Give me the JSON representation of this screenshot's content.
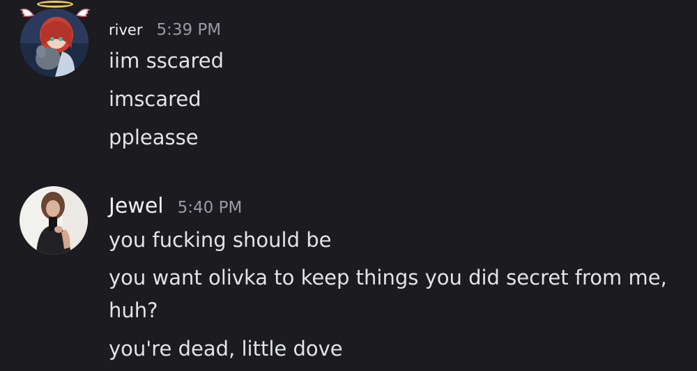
{
  "colors": {
    "background": "#1b1b20",
    "text": "#e3e4e8",
    "timestamp": "#9a9ba3",
    "halo": "#f2c94c"
  },
  "messages": [
    {
      "author": "river",
      "time": "5:39 PM",
      "avatar_icon": "anime-girl-avatar-icon",
      "lines": [
        "iim sscared",
        "imscared",
        "ppleasse"
      ]
    },
    {
      "author": "Jewel",
      "time": "5:40 PM",
      "avatar_icon": "selfie-photo-avatar-icon",
      "lines": [
        "you fucking should be",
        "you want olivka to keep things you did secret from me,",
        "huh?",
        "you're dead, little dove"
      ]
    }
  ]
}
